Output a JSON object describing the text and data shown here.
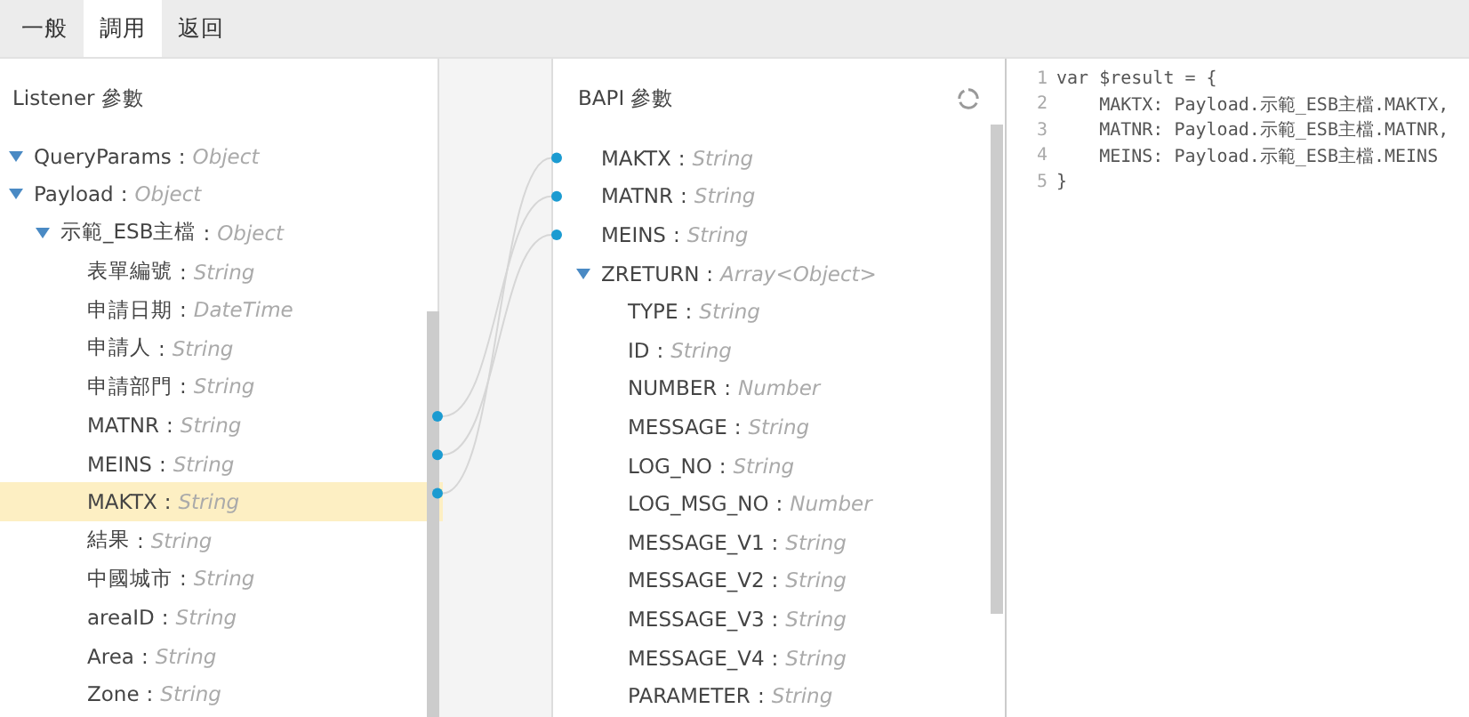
{
  "separator": ":",
  "tabs": [
    {
      "label": "一般",
      "selected": false
    },
    {
      "label": "調用",
      "selected": true
    },
    {
      "label": "返回",
      "selected": false
    }
  ],
  "listener": {
    "title": "Listener 參數",
    "items": [
      {
        "name": "QueryParams",
        "type": "Object",
        "expanded": true,
        "linked": false,
        "selected": false
      },
      {
        "name": "Payload",
        "type": "Object",
        "expanded": true,
        "linked": false,
        "selected": false,
        "children": [
          {
            "name": "示範_ESB主檔",
            "type": "Object",
            "expanded": true,
            "linked": false,
            "selected": false,
            "children": [
              {
                "name": "表單編號",
                "type": "String",
                "linked": false,
                "selected": false
              },
              {
                "name": "申請日期",
                "type": "DateTime",
                "linked": false,
                "selected": false
              },
              {
                "name": "申請人",
                "type": "String",
                "linked": false,
                "selected": false
              },
              {
                "name": "申請部門",
                "type": "String",
                "linked": false,
                "selected": false
              },
              {
                "name": "MATNR",
                "type": "String",
                "linked": true,
                "selected": false
              },
              {
                "name": "MEINS",
                "type": "String",
                "linked": true,
                "selected": false
              },
              {
                "name": "MAKTX",
                "type": "String",
                "linked": true,
                "selected": true
              },
              {
                "name": "結果",
                "type": "String",
                "linked": false,
                "selected": false
              },
              {
                "name": "中國城市",
                "type": "String",
                "linked": false,
                "selected": false
              },
              {
                "name": "areaID",
                "type": "String",
                "linked": false,
                "selected": false
              },
              {
                "name": "Area",
                "type": "String",
                "linked": false,
                "selected": false
              },
              {
                "name": "Zone",
                "type": "String",
                "linked": false,
                "selected": false
              }
            ]
          }
        ]
      }
    ]
  },
  "bapi": {
    "title": "BAPI 參數",
    "items": [
      {
        "name": "MAKTX",
        "type": "String",
        "linked": true,
        "selected": false
      },
      {
        "name": "MATNR",
        "type": "String",
        "linked": true,
        "selected": false
      },
      {
        "name": "MEINS",
        "type": "String",
        "linked": true,
        "selected": false
      },
      {
        "name": "ZRETURN",
        "type": "Array<Object>",
        "expanded": true,
        "linked": false,
        "selected": false,
        "children": [
          {
            "name": "TYPE",
            "type": "String",
            "linked": false,
            "selected": false
          },
          {
            "name": "ID",
            "type": "String",
            "linked": false,
            "selected": false
          },
          {
            "name": "NUMBER",
            "type": "Number",
            "linked": false,
            "selected": false
          },
          {
            "name": "MESSAGE",
            "type": "String",
            "linked": false,
            "selected": false
          },
          {
            "name": "LOG_NO",
            "type": "String",
            "linked": false,
            "selected": false
          },
          {
            "name": "LOG_MSG_NO",
            "type": "Number",
            "linked": false,
            "selected": false
          },
          {
            "name": "MESSAGE_V1",
            "type": "String",
            "linked": false,
            "selected": false
          },
          {
            "name": "MESSAGE_V2",
            "type": "String",
            "linked": false,
            "selected": false
          },
          {
            "name": "MESSAGE_V3",
            "type": "String",
            "linked": false,
            "selected": false
          },
          {
            "name": "MESSAGE_V4",
            "type": "String",
            "linked": false,
            "selected": false
          },
          {
            "name": "PARAMETER",
            "type": "String",
            "linked": false,
            "selected": false
          }
        ]
      }
    ]
  },
  "code": {
    "lines": [
      {
        "number": "1",
        "text": "var $result = {"
      },
      {
        "number": "2",
        "text": "    MAKTX: Payload.示範_ESB主檔.MAKTX,"
      },
      {
        "number": "3",
        "text": "    MATNR: Payload.示範_ESB主檔.MATNR,"
      },
      {
        "number": "4",
        "text": "    MEINS: Payload.示範_ESB主檔.MEINS"
      },
      {
        "number": "5",
        "text": "}"
      }
    ]
  }
}
